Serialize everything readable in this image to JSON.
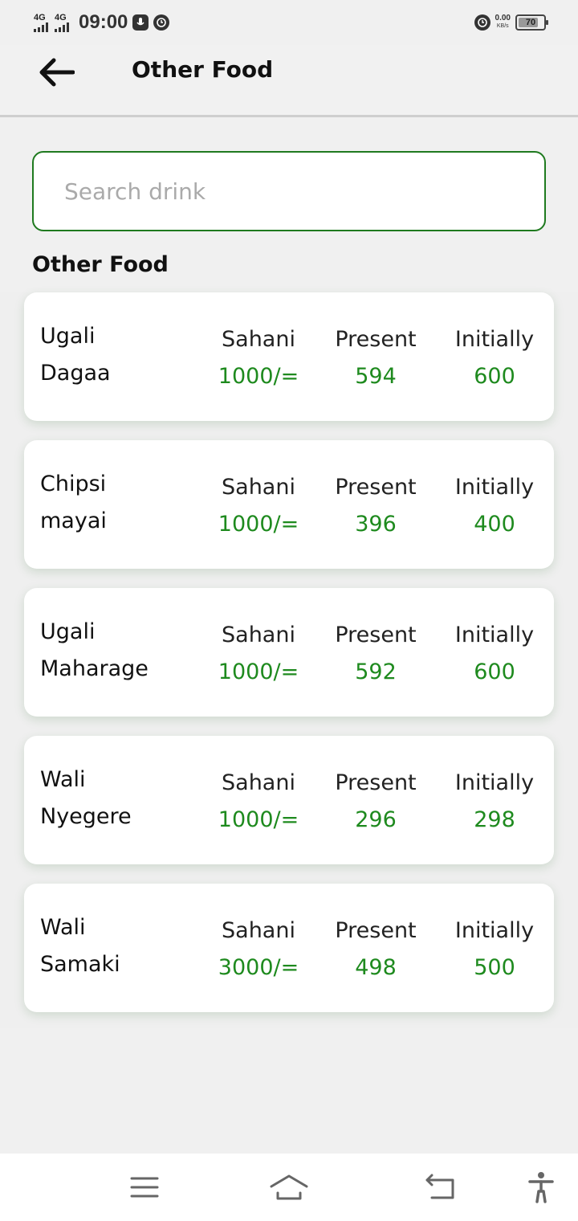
{
  "status_bar": {
    "network_1": "4G",
    "network_2": "4G",
    "time": "09:00",
    "speed_value": "0.00",
    "speed_unit": "KB/s",
    "battery_level": "70"
  },
  "app_bar": {
    "title": "Other Food"
  },
  "search": {
    "placeholder": "Search drink",
    "value": ""
  },
  "section": {
    "title": "Other Food"
  },
  "columns": {
    "price_label": "Sahani",
    "present_label": "Present",
    "initial_label": "Initially"
  },
  "items": [
    {
      "name_line1": "Ugali",
      "name_line2": "Dagaa",
      "price": "1000/=",
      "present": "594",
      "initially": "600"
    },
    {
      "name_line1": "Chipsi",
      "name_line2": "mayai",
      "price": "1000/=",
      "present": "396",
      "initially": "400"
    },
    {
      "name_line1": "Ugali",
      "name_line2": "Maharage",
      "price": "1000/=",
      "present": "592",
      "initially": "600"
    },
    {
      "name_line1": "Wali",
      "name_line2": "Nyegere",
      "price": "1000/=",
      "present": "296",
      "initially": "298"
    },
    {
      "name_line1": "Wali",
      "name_line2": "Samaki",
      "price": "3000/=",
      "present": "498",
      "initially": "500"
    }
  ],
  "colors": {
    "accent_green": "#1e8a1e",
    "search_border": "#1f7a1f",
    "background": "#f0f0f0",
    "card": "#ffffff"
  },
  "icons": {
    "back": "arrow-left-icon",
    "menu": "menu-icon",
    "home": "home-icon",
    "back_nav": "return-icon",
    "accessibility": "accessibility-icon"
  }
}
